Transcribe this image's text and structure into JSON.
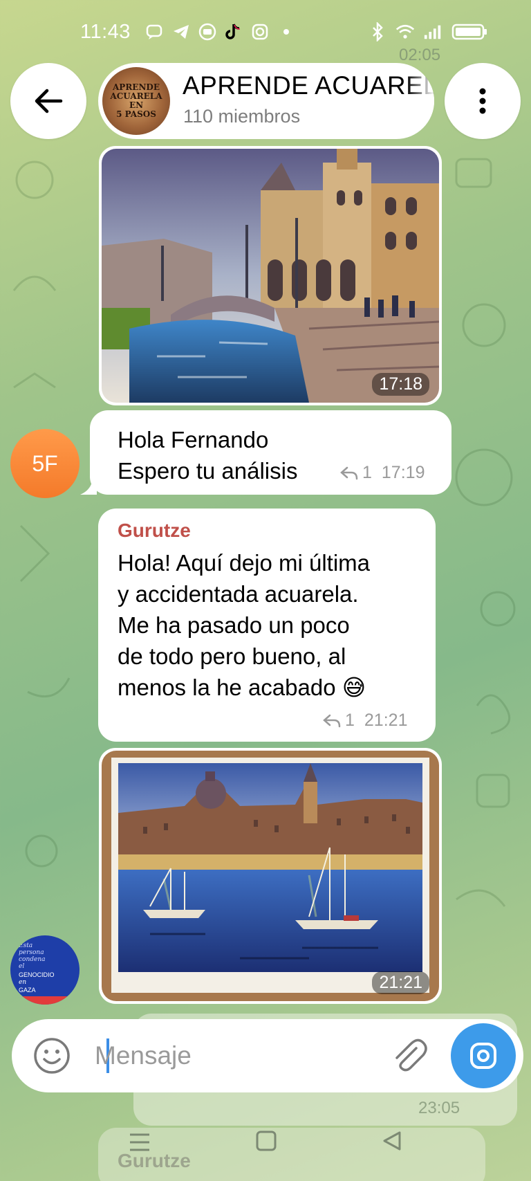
{
  "status_bar": {
    "time": "11:43"
  },
  "header": {
    "group_name": "APRENDE ACUARELA",
    "members": "110 miembros",
    "avatar_text": [
      "APRENDE",
      "ACUARELA",
      "EN",
      "5 PASOS"
    ]
  },
  "messages": [
    {
      "type": "photo",
      "subject": "watercolor-bridge-palace",
      "time": "17:18"
    },
    {
      "type": "text",
      "sender_avatar": "5F",
      "lines": [
        "Hola Fernando",
        "Espero tu análisis"
      ],
      "replies": "1",
      "time": "17:19"
    },
    {
      "type": "text",
      "sender": "Gurutze",
      "lines": [
        "Hola! Aquí dejo mi última",
        "y accidentada acuarela.",
        "Me ha pasado un poco",
        "de todo pero bueno, al",
        "menos la he acabado 😅"
      ],
      "replies": "1",
      "time": "21:21"
    },
    {
      "type": "photo",
      "subject": "watercolor-harbour-boats",
      "time": "21:21"
    }
  ],
  "gaza_avatar": {
    "small_text": [
      "Esta",
      "persona",
      "condena",
      "el"
    ],
    "big_text": [
      "GENOCIDIO",
      "en",
      "GAZA"
    ]
  },
  "background_faded": {
    "time_top": "02:05",
    "time_bottom": "23:05",
    "sender": "Gurutze"
  },
  "composer": {
    "placeholder": "Mensaje",
    "emoji_icon": "smiley-icon",
    "attach_icon": "paperclip-icon",
    "camera_icon": "camera-icon"
  },
  "colors": {
    "accent": "#3d9bea",
    "sender_name": "#c0504a",
    "avatar_orange": "#f47a2a"
  }
}
